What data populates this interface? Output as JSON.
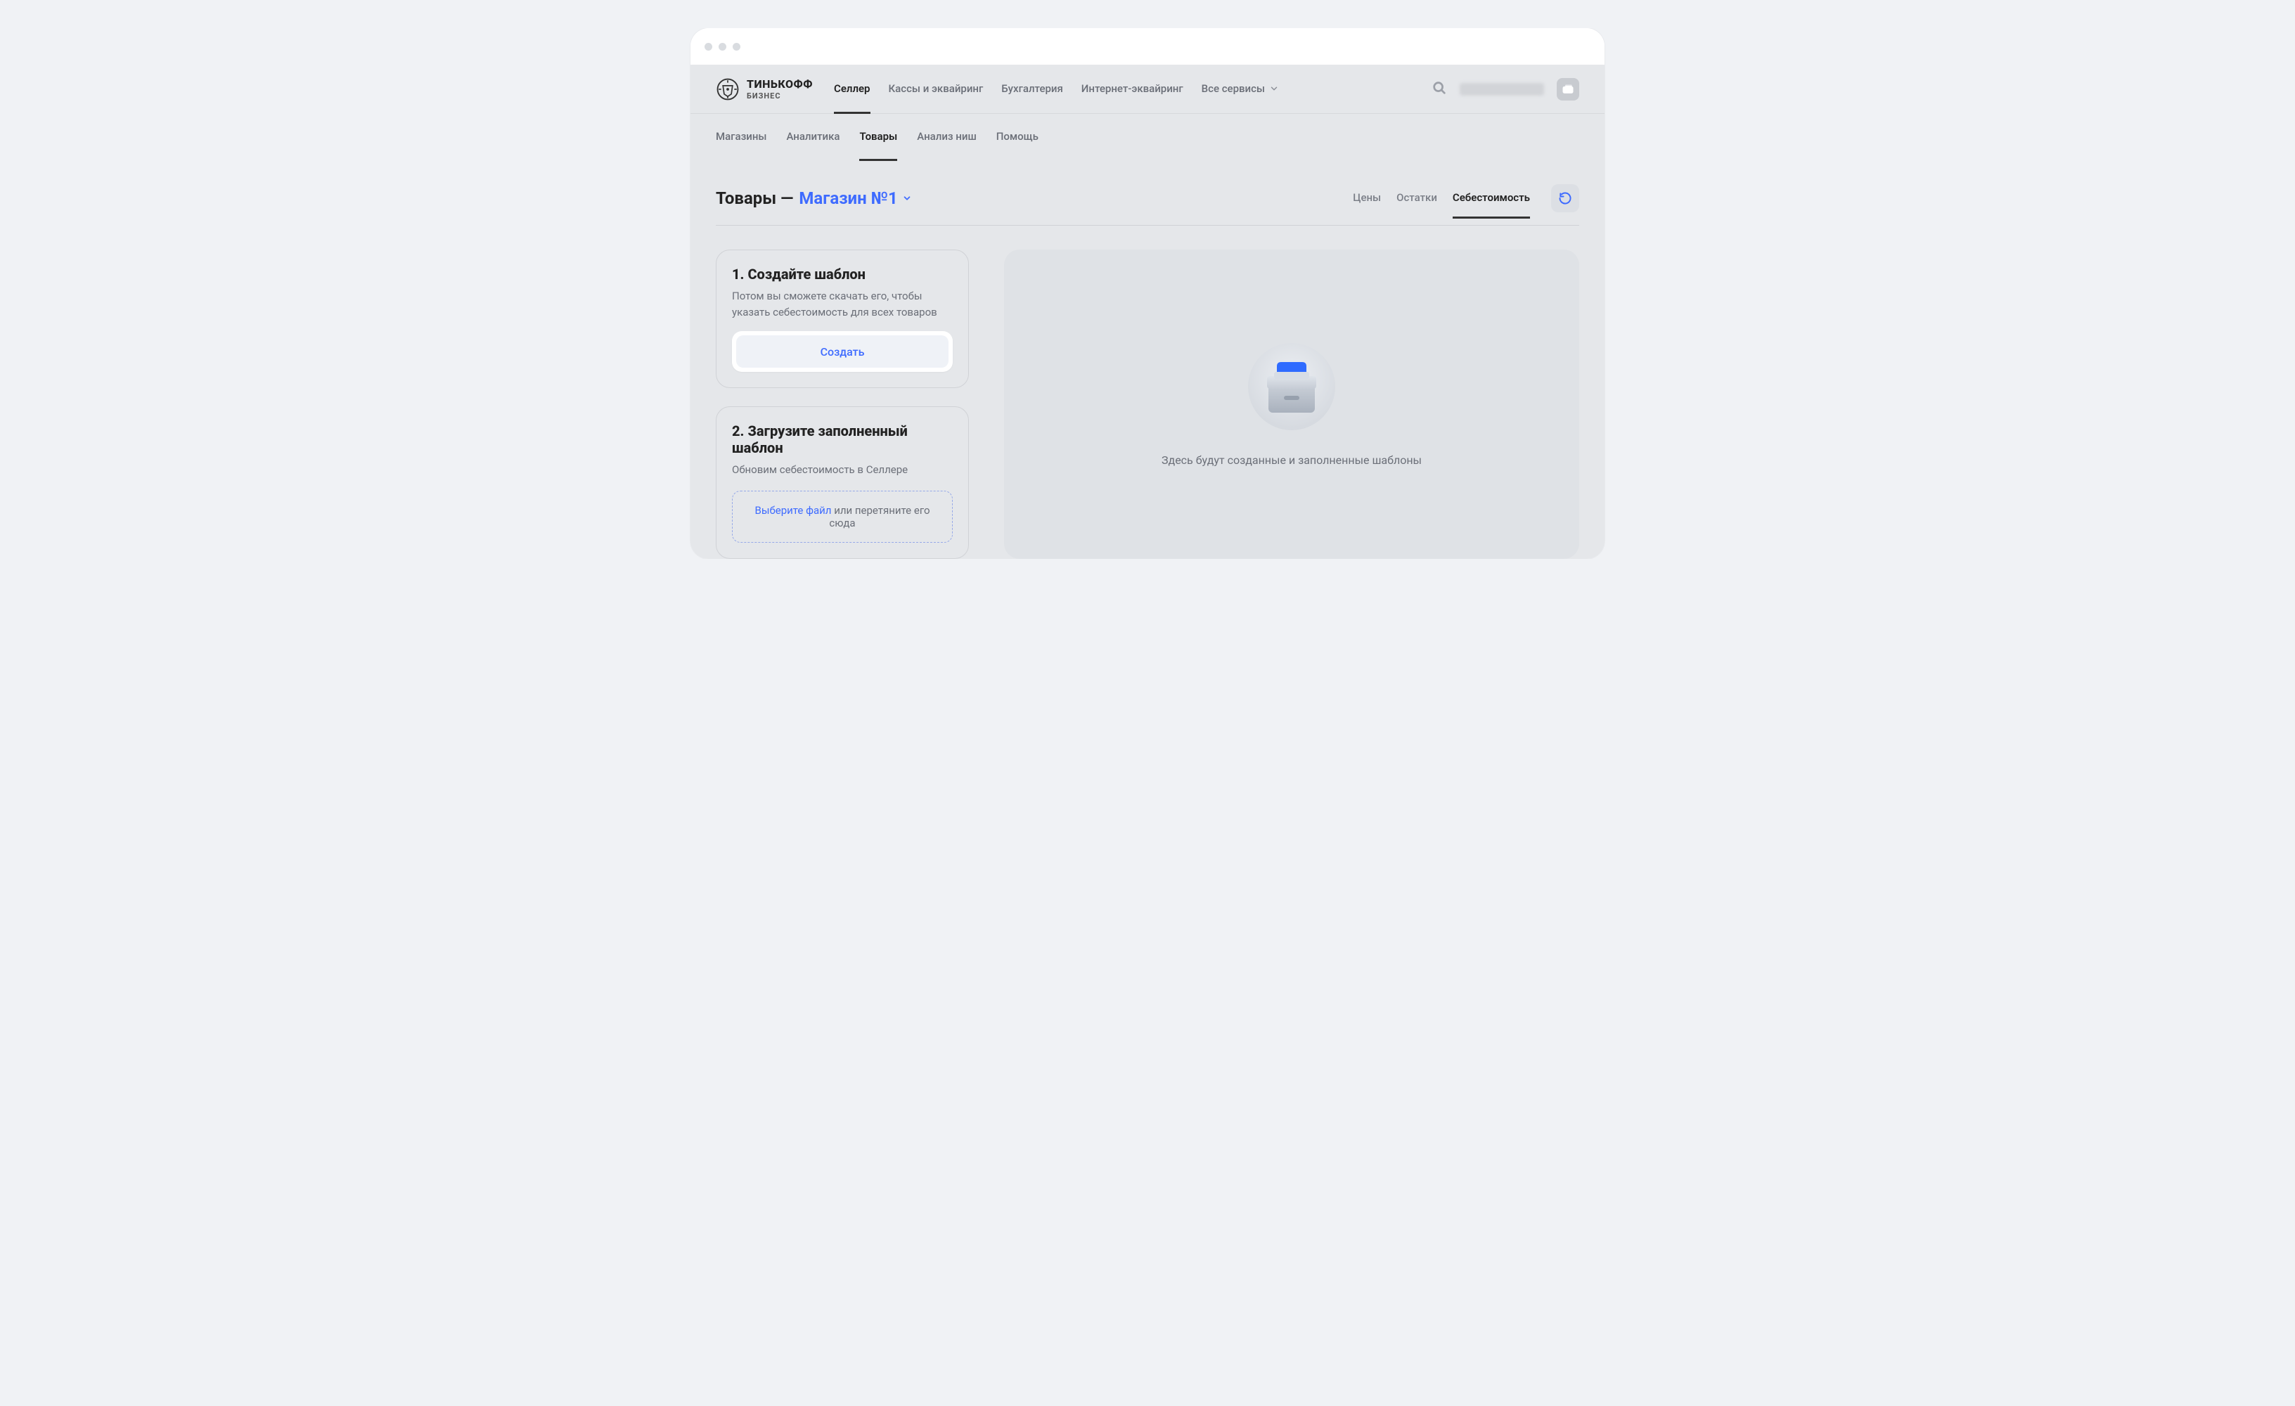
{
  "logo": {
    "line1": "ТИНЬКОФФ",
    "line2": "БИЗНЕС"
  },
  "primaryNav": {
    "items": [
      {
        "label": "Селлер",
        "active": true
      },
      {
        "label": "Кассы и эквайринг"
      },
      {
        "label": "Бухгалтерия"
      },
      {
        "label": "Интернет-эквайринг"
      },
      {
        "label": "Все сервисы",
        "hasDropdown": true
      }
    ]
  },
  "subNav": {
    "items": [
      {
        "label": "Магазины"
      },
      {
        "label": "Аналитика"
      },
      {
        "label": "Товары",
        "active": true
      },
      {
        "label": "Анализ ниш"
      },
      {
        "label": "Помощь"
      }
    ]
  },
  "pageHeader": {
    "titlePrefix": "Товары — ",
    "shopName": "Магазин №1"
  },
  "pageTabs": {
    "items": [
      {
        "label": "Цены"
      },
      {
        "label": "Остатки"
      },
      {
        "label": "Себестоимость",
        "active": true
      }
    ]
  },
  "steps": {
    "step1": {
      "title": "1. Создайте шаблон",
      "desc": "Потом вы сможете скачать его, чтобы указать себестоимость для всех товаров",
      "button": "Создать"
    },
    "step2": {
      "title": "2. Загрузите заполненный шаблон",
      "desc": "Обновим себестоимость в Селлере",
      "dropzoneLink": "Выберите файл",
      "dropzoneRest": " или перетяните его сюда"
    }
  },
  "mainPanel": {
    "emptyText": "Здесь будут созданные и заполненные шаблоны"
  }
}
